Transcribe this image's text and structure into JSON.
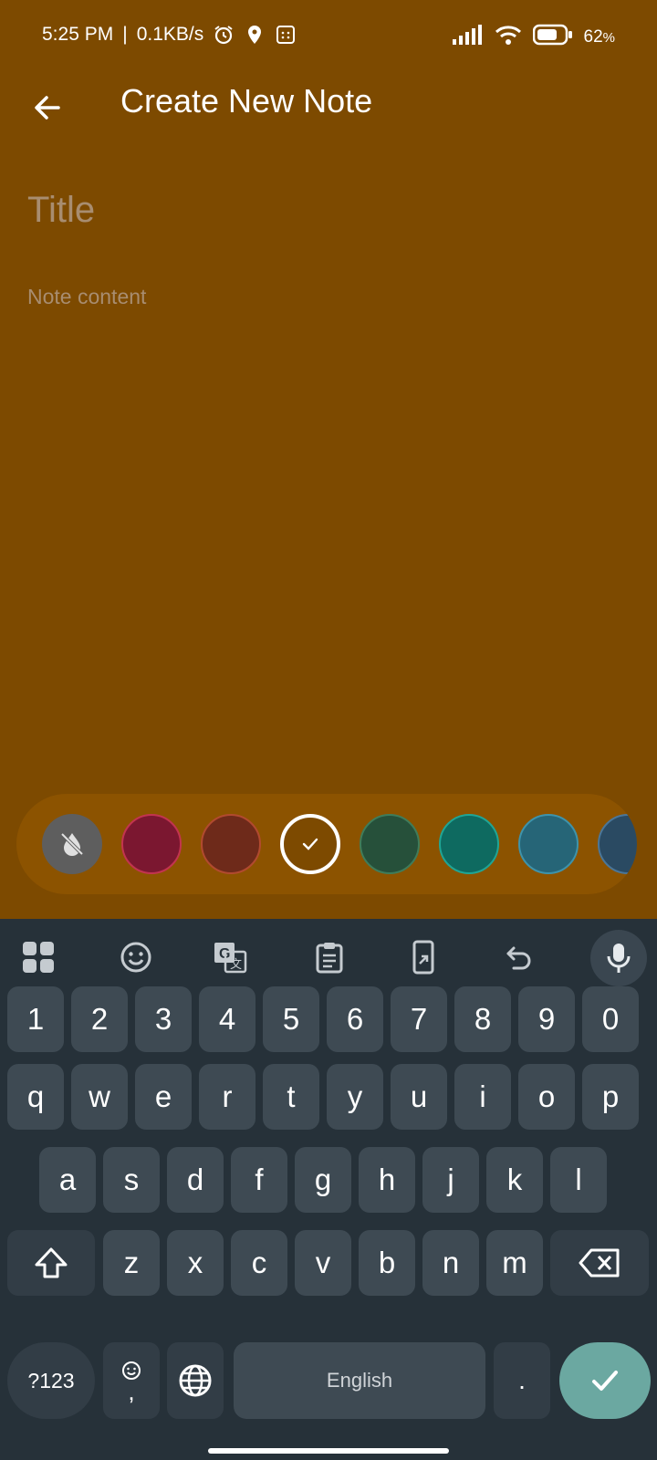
{
  "status_bar": {
    "time": "5:25 PM",
    "net_speed": "0.1KB/s",
    "battery": "62"
  },
  "app_bar": {
    "title": "Create New Note"
  },
  "editor": {
    "title_placeholder": "Title",
    "content_placeholder": "Note content"
  },
  "palette": {
    "colors": [
      "#5e5e5e",
      "#7b1730",
      "#6e2a1a",
      "#7d4a00",
      "#26503a",
      "#0e6a60",
      "#266577",
      "#2a4a62"
    ],
    "selected_index": 3
  },
  "keyboard": {
    "row_numbers": [
      "1",
      "2",
      "3",
      "4",
      "5",
      "6",
      "7",
      "8",
      "9",
      "0"
    ],
    "row_q": [
      "q",
      "w",
      "e",
      "r",
      "t",
      "y",
      "u",
      "i",
      "o",
      "p"
    ],
    "row_a": [
      "a",
      "s",
      "d",
      "f",
      "g",
      "h",
      "j",
      "k",
      "l"
    ],
    "row_z": [
      "z",
      "x",
      "c",
      "v",
      "b",
      "n",
      "m"
    ],
    "symbols_label": "?123",
    "comma_label": ",",
    "space_label": "English",
    "period_label": "."
  }
}
